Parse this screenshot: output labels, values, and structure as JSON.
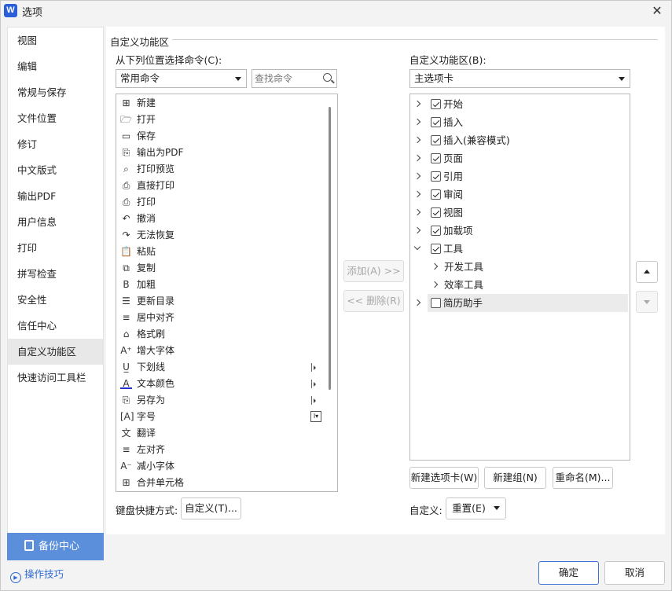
{
  "window": {
    "title": "选项",
    "logo": "W",
    "close_icon": "close-icon"
  },
  "sidebar": {
    "items": [
      {
        "label": "视图"
      },
      {
        "label": "编辑"
      },
      {
        "label": "常规与保存"
      },
      {
        "label": "文件位置"
      },
      {
        "label": "修订"
      },
      {
        "label": "中文版式"
      },
      {
        "label": "输出PDF"
      },
      {
        "label": "用户信息"
      },
      {
        "label": "打印"
      },
      {
        "label": "拼写检查"
      },
      {
        "label": "安全性"
      },
      {
        "label": "信任中心"
      },
      {
        "label": "自定义功能区",
        "active": true
      },
      {
        "label": "快速访问工具栏"
      }
    ],
    "backup_label": "备份中心",
    "tips_label": "操作技巧"
  },
  "main": {
    "group_title": "自定义功能区",
    "choose_label": "从下列位置选择命令(C):",
    "choose_value": "常用命令",
    "search_placeholder": "查找命令",
    "commands": [
      {
        "label": "新建",
        "icon": "new-doc-icon",
        "glyph": "⊞"
      },
      {
        "label": "打开",
        "icon": "folder-open-icon",
        "glyph": "🗁"
      },
      {
        "label": "保存",
        "icon": "save-icon",
        "glyph": "▭"
      },
      {
        "label": "输出为PDF",
        "icon": "pdf-export-icon",
        "glyph": "⎘"
      },
      {
        "label": "打印预览",
        "icon": "print-preview-icon",
        "glyph": "⌕"
      },
      {
        "label": "直接打印",
        "icon": "direct-print-icon",
        "glyph": "⎙"
      },
      {
        "label": "打印",
        "icon": "print-icon",
        "glyph": "⎙"
      },
      {
        "label": "撤消",
        "icon": "undo-icon",
        "glyph": "↶"
      },
      {
        "label": "无法恢复",
        "icon": "redo-icon",
        "glyph": "↷"
      },
      {
        "label": "粘贴",
        "icon": "paste-icon",
        "glyph": "📋"
      },
      {
        "label": "复制",
        "icon": "copy-icon",
        "glyph": "⧉"
      },
      {
        "label": "加粗",
        "icon": "bold-icon",
        "glyph": "B"
      },
      {
        "label": "更新目录",
        "icon": "update-toc-icon",
        "glyph": "☰"
      },
      {
        "label": "居中对齐",
        "icon": "align-center-icon",
        "glyph": "≡"
      },
      {
        "label": "格式刷",
        "icon": "format-painter-icon",
        "glyph": "⌂"
      },
      {
        "label": "增大字体",
        "icon": "font-grow-icon",
        "glyph": "A⁺"
      },
      {
        "label": "下划线",
        "icon": "underline-icon",
        "glyph": "U̲",
        "submenu": true
      },
      {
        "label": "文本颜色",
        "icon": "font-color-icon",
        "glyph": "A",
        "submenu": true
      },
      {
        "label": "另存为",
        "icon": "save-as-icon",
        "glyph": "⎘",
        "submenu": true
      },
      {
        "label": "字号",
        "icon": "font-size-icon",
        "glyph": "[A]",
        "sizebox": true
      },
      {
        "label": "翻译",
        "icon": "translate-icon",
        "glyph": "文"
      },
      {
        "label": "左对齐",
        "icon": "align-left-icon",
        "glyph": "≡"
      },
      {
        "label": "减小字体",
        "icon": "font-shrink-icon",
        "glyph": "A⁻"
      },
      {
        "label": "合并单元格",
        "icon": "merge-cells-icon",
        "glyph": "⊞"
      }
    ],
    "add_button": "添加(A) >>",
    "remove_button": "<< 删除(R)",
    "ribbon_label": "自定义功能区(B):",
    "ribbon_value": "主选项卡",
    "tree": [
      {
        "label": "开始",
        "checked": true,
        "expanded": false,
        "level": 0
      },
      {
        "label": "插入",
        "checked": true,
        "expanded": false,
        "level": 0
      },
      {
        "label": "插入(兼容模式)",
        "checked": true,
        "expanded": false,
        "level": 0
      },
      {
        "label": "页面",
        "checked": true,
        "expanded": false,
        "level": 0
      },
      {
        "label": "引用",
        "checked": true,
        "expanded": false,
        "level": 0
      },
      {
        "label": "审阅",
        "checked": true,
        "expanded": false,
        "level": 0
      },
      {
        "label": "视图",
        "checked": true,
        "expanded": false,
        "level": 0
      },
      {
        "label": "加载项",
        "checked": true,
        "expanded": false,
        "level": 0
      },
      {
        "label": "工具",
        "checked": true,
        "expanded": true,
        "level": 0
      },
      {
        "label": "开发工具",
        "level": 1
      },
      {
        "label": "效率工具",
        "level": 1
      },
      {
        "label": "简历助手",
        "checked": false,
        "expanded": false,
        "level": 0,
        "highlight": true
      }
    ],
    "new_tab_button": "新建选项卡(W)",
    "new_group_button": "新建组(N)",
    "rename_button": "重命名(M)...",
    "keyboard_label": "键盘快捷方式:",
    "keyboard_button": "自定义(T)...",
    "custom_label": "自定义:",
    "reset_button": "重置(E)"
  },
  "footer": {
    "ok_button": "确定",
    "cancel_button": "取消"
  }
}
